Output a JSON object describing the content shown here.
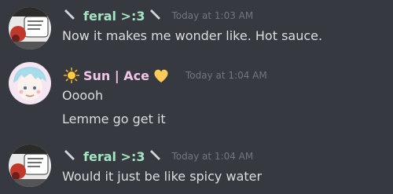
{
  "messages": [
    {
      "username": "feral >:3",
      "username_color": "#a3e4c1",
      "timestamp": "Today at 1:03 AM",
      "lead_emoji": "knife-emoji",
      "trail_emoji": "knife-emoji",
      "lines": [
        "Now it makes me wonder like. Hot sauce."
      ]
    },
    {
      "username": "Sun | Ace",
      "username_color": "#f1c4e8",
      "timestamp": "Today at 1:04 AM",
      "lead_emoji": "sun-emoji",
      "trail_emoji": "yellow-heart-emoji",
      "lines": [
        "Ooooh",
        "Lemme go get it"
      ]
    },
    {
      "username": "feral >:3",
      "username_color": "#a3e4c1",
      "timestamp": "Today at 1:04 AM",
      "lead_emoji": "knife-emoji",
      "trail_emoji": "knife-emoji",
      "lines": [
        "Would it just be like spicy water"
      ]
    }
  ]
}
